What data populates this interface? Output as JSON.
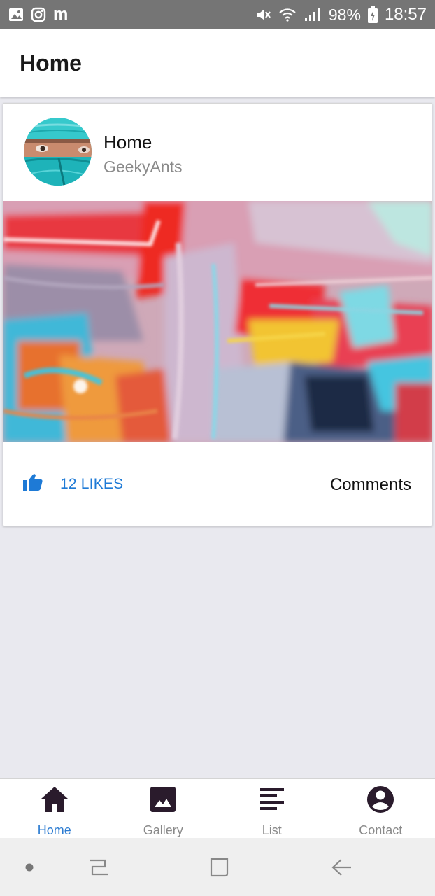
{
  "status_bar": {
    "battery": "98%",
    "time": "18:57",
    "left_icons": [
      "image-icon",
      "instagram-icon",
      "m-app-icon"
    ],
    "right_icons": [
      "mute-icon",
      "wifi-icon",
      "signal-icon",
      "battery-charging-icon"
    ],
    "m_glyph": "m"
  },
  "header": {
    "title": "Home"
  },
  "card": {
    "title": "Home",
    "subtitle": "GeekyAnts",
    "likes_label": "12 LIKES",
    "comments_label": "Comments"
  },
  "tabs": [
    {
      "label": "Home",
      "icon": "home-icon",
      "active": true
    },
    {
      "label": "Gallery",
      "icon": "image-icon",
      "active": false
    },
    {
      "label": "List",
      "icon": "list-icon",
      "active": false
    },
    {
      "label": "Contact",
      "icon": "account-icon",
      "active": false
    }
  ],
  "colors": {
    "accent": "#2b7bd1",
    "likes": "#1e7ad6",
    "tab_icon": "#2a1b2c",
    "status_bar": "#757575",
    "background": "#e9e9ef"
  }
}
